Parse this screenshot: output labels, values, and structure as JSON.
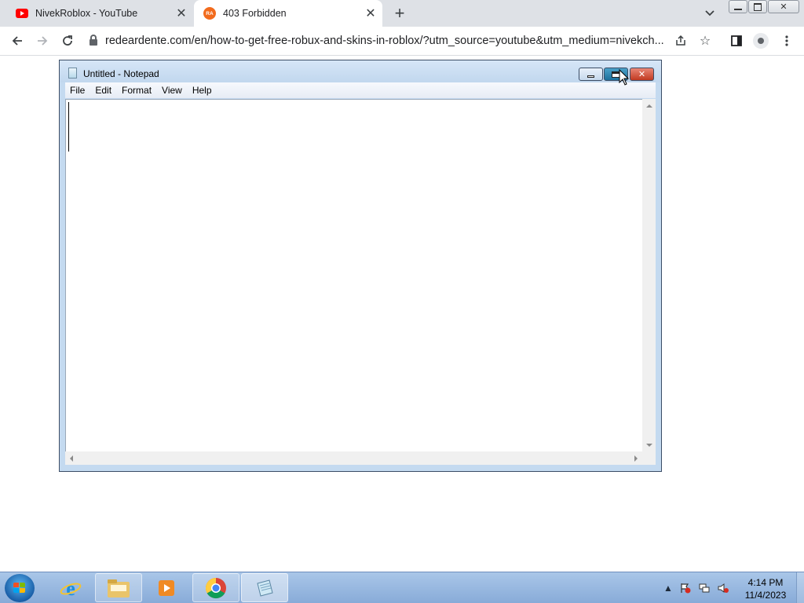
{
  "browser": {
    "tabs": [
      {
        "title": "NivekRoblox - YouTube",
        "icon": "youtube-icon"
      },
      {
        "title": "403 Forbidden",
        "icon": "site-favicon-icon",
        "favicon_text": "RA"
      }
    ],
    "new_tab_label": "+",
    "url": "redeardente.com/en/how-to-get-free-robux-and-skins-in-roblox/?utm_source=youtube&utm_medium=nivekch..."
  },
  "notepad": {
    "title": "Untitled - Notepad",
    "menu": [
      "File",
      "Edit",
      "Format",
      "View",
      "Help"
    ],
    "content": ""
  },
  "taskbar": {
    "time": "4:14 PM",
    "date": "11/4/2023"
  },
  "colors": {
    "accent_blue": "#1a73e8",
    "youtube_red": "#ff0000",
    "favicon_orange": "#f26b1d",
    "close_red": "#c13a22"
  }
}
